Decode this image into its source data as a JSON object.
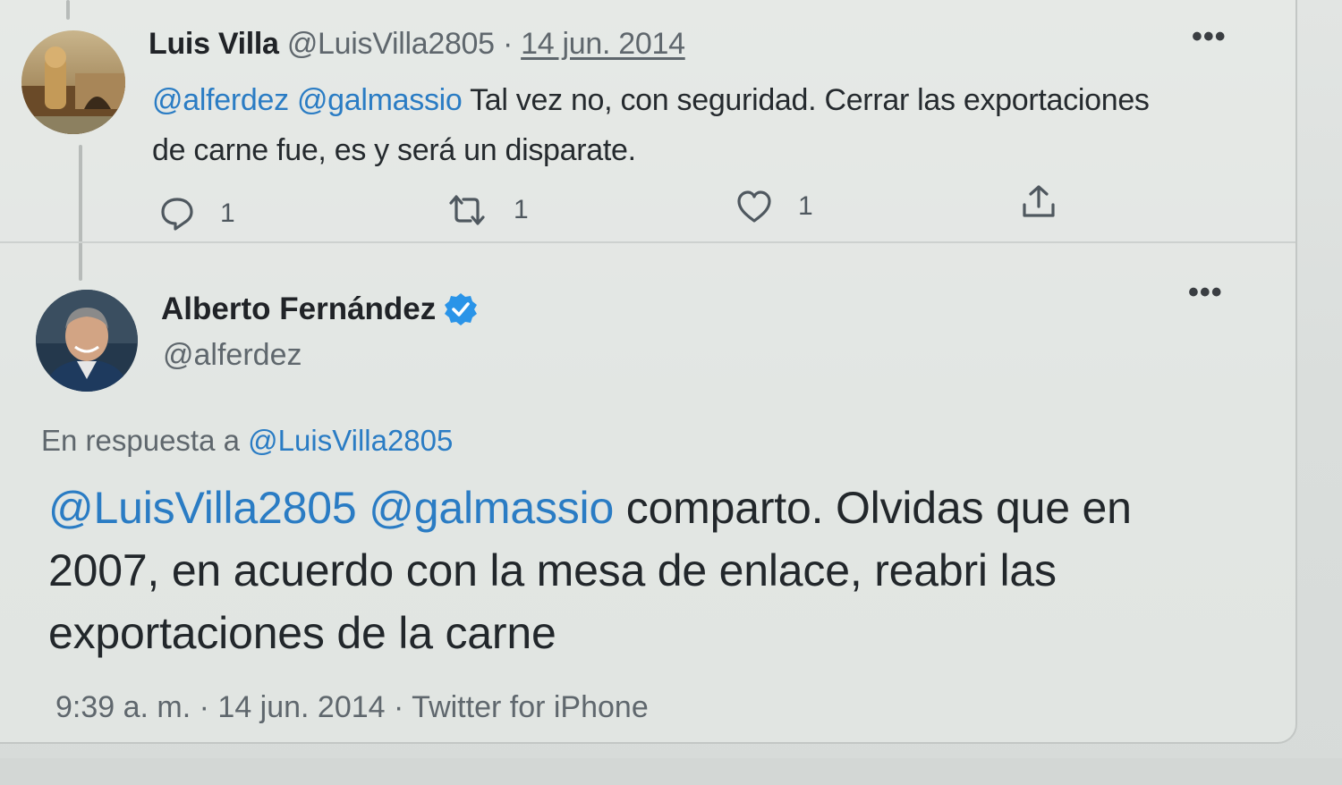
{
  "tweet1": {
    "name": "Luis Villa",
    "handle": "@LuisVilla2805",
    "separator": "·",
    "date": "14 jun. 2014",
    "more": "•••",
    "mention1": "@alferdez",
    "mention2": "@galmassio",
    "text_line1": "Tal vez no, con seguridad. Cerrar las exportaciones",
    "text_line2": "de carne fue, es y será un disparate.",
    "replies": "1",
    "retweets": "1",
    "likes": "1"
  },
  "tweet2": {
    "name": "Alberto Fernández",
    "handle": "@alferdez",
    "more": "•••",
    "reply_prefix": "En respuesta a",
    "reply_handle": "@LuisVilla2805",
    "mention1": "@LuisVilla2805",
    "mention2": "@galmassio",
    "text_line1": "comparto. Olvidas que en",
    "text_line2": "2007, en acuerdo con la mesa de enlace, reabri las",
    "text_line3": "exportaciones de la carne",
    "meta": "9:39 a. m. · 14 jun. 2014 · Twitter for iPhone"
  },
  "colors": {
    "mention": "#2a7cc4",
    "verified": "#2a94e8",
    "muted": "#5f676d",
    "text": "#202327"
  },
  "icons": {
    "reply": "reply-icon",
    "retweet": "retweet-icon",
    "like": "heart-icon",
    "share": "share-icon",
    "verified": "verified-badge-icon"
  }
}
